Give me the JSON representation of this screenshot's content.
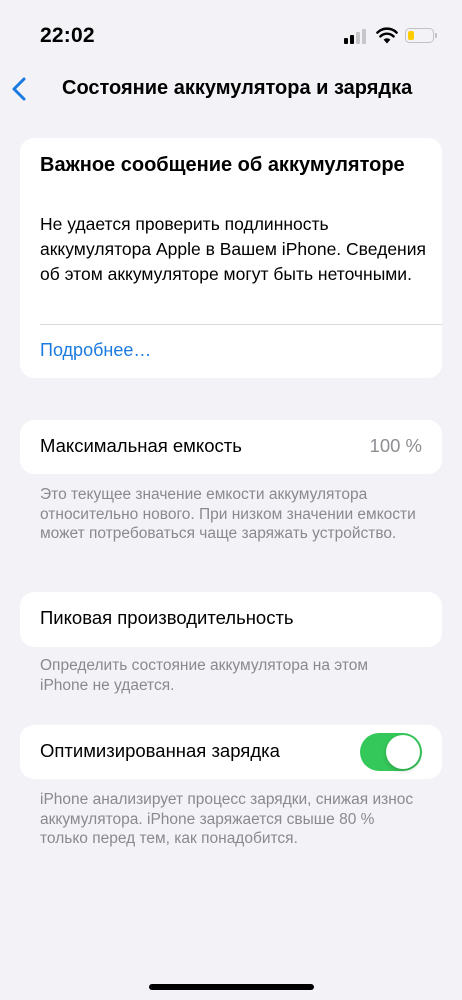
{
  "status_bar": {
    "time": "22:02",
    "icons": [
      "cellular-signal-icon",
      "wifi-icon",
      "battery-icon"
    ],
    "battery_level": 0.3,
    "battery_color": "#ffcc00"
  },
  "nav": {
    "back_icon": "chevron-left-icon",
    "title": "Состояние аккумулятора и зарядка"
  },
  "alert": {
    "title": "Важное сообщение об аккумуляторе",
    "body": "Не удается проверить подлинность аккумулятора Apple в Вашем iPhone. Сведения об этом аккумуляторе могут быть неточными.",
    "link": "Подробнее…",
    "link_color": "#1a7ae0"
  },
  "capacity": {
    "label": "Максимальная емкость",
    "value": "100 %",
    "footnote": "Это текущее значение емкости аккумулятора относительно нового. При низком значении емкости может потребоваться чаще заряжать устройство."
  },
  "peak": {
    "label": "Пиковая производительность",
    "footnote": "Определить состояние аккумулятора на этом iPhone не удается."
  },
  "optimized_charging": {
    "label": "Оптимизированная зарядка",
    "enabled": true,
    "toggle_color": "#34c759",
    "footnote": "iPhone анализирует процесс зарядки, снижая износ аккумулятора. iPhone заряжается свыше 80 % только перед тем, как понадобится."
  }
}
